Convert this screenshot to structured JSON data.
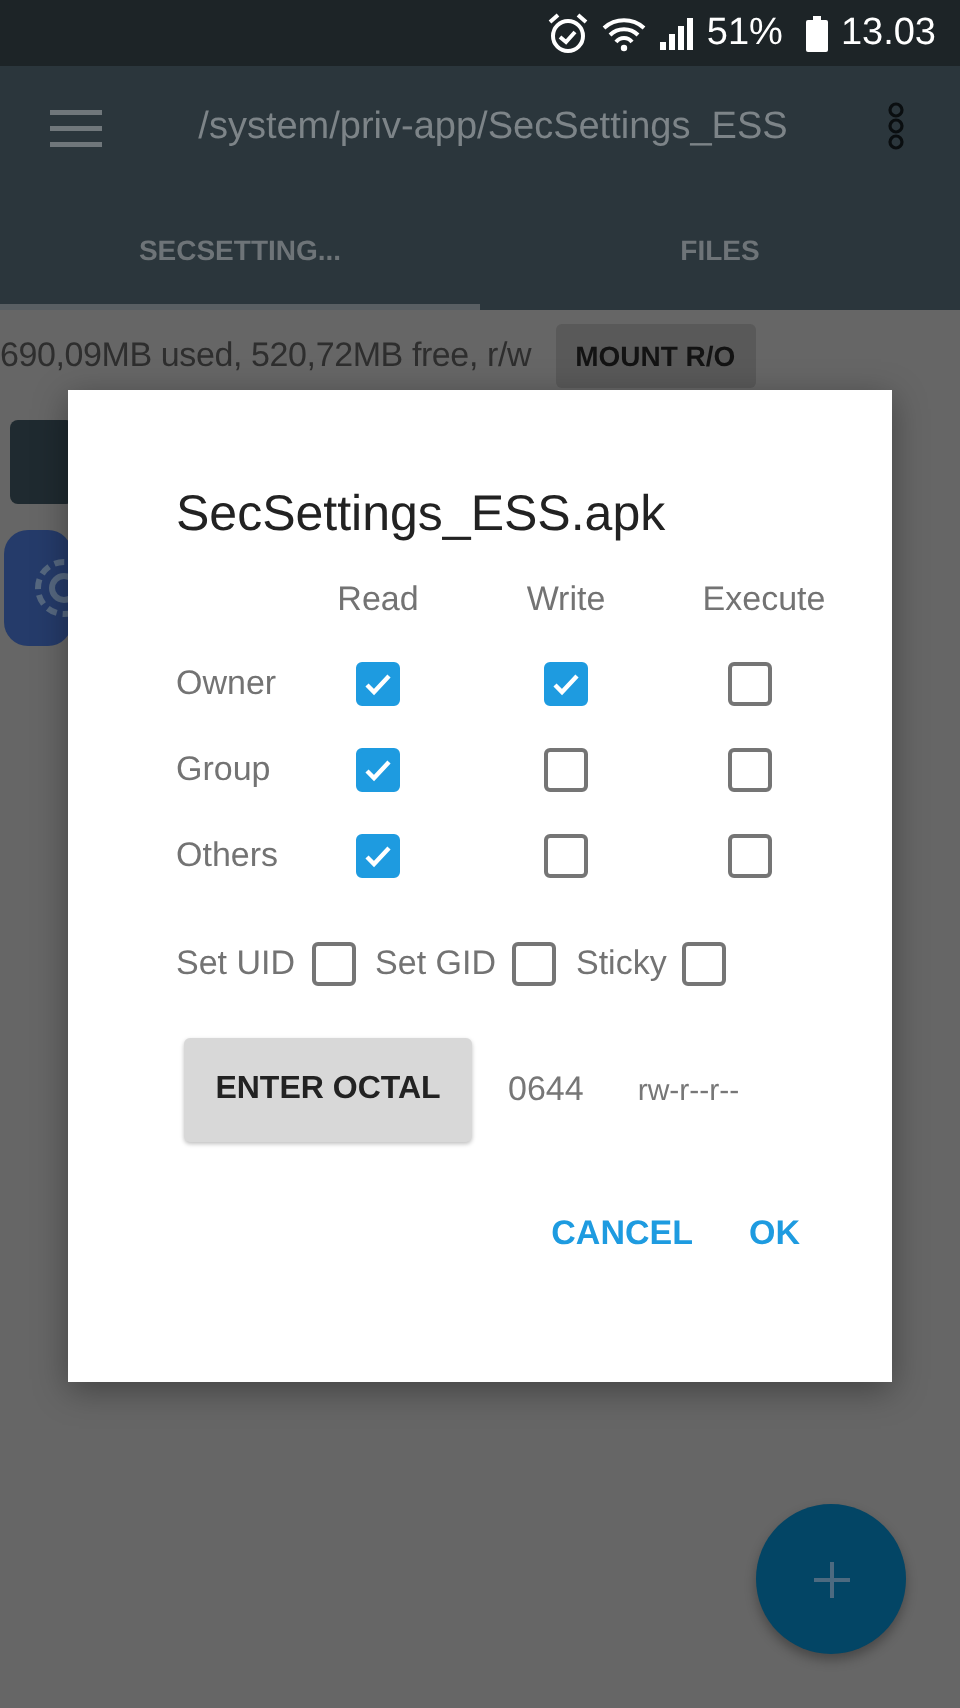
{
  "status_bar": {
    "battery": "51%",
    "time": "13.03"
  },
  "app_bar": {
    "path": "/system/priv-app/SecSettings_ESS"
  },
  "tabs": [
    {
      "label": "SECSETTING...",
      "selected": true
    },
    {
      "label": "FILES",
      "selected": false
    }
  ],
  "storage": {
    "text": "690,09MB used, 520,72MB free, r/w",
    "button": "MOUNT R/O"
  },
  "dialog": {
    "title": "SecSettings_ESS.apk",
    "columns": [
      "Read",
      "Write",
      "Execute"
    ],
    "rows": [
      {
        "label": "Owner",
        "permissions": [
          {
            "checked": true
          },
          {
            "checked": true
          },
          {
            "checked": false
          }
        ]
      },
      {
        "label": "Group",
        "permissions": [
          {
            "checked": true
          },
          {
            "checked": false
          },
          {
            "checked": false
          }
        ]
      },
      {
        "label": "Others",
        "permissions": [
          {
            "checked": true
          },
          {
            "checked": false
          },
          {
            "checked": false
          }
        ]
      }
    ],
    "special": [
      {
        "label": "Set UID",
        "checked": false
      },
      {
        "label": "Set GID",
        "checked": false
      },
      {
        "label": "Sticky",
        "checked": false
      }
    ],
    "octal_button": "ENTER OCTAL",
    "octal": "0644",
    "symbolic": "rw-r--r--",
    "buttons": [
      "CANCEL",
      "OK"
    ]
  }
}
